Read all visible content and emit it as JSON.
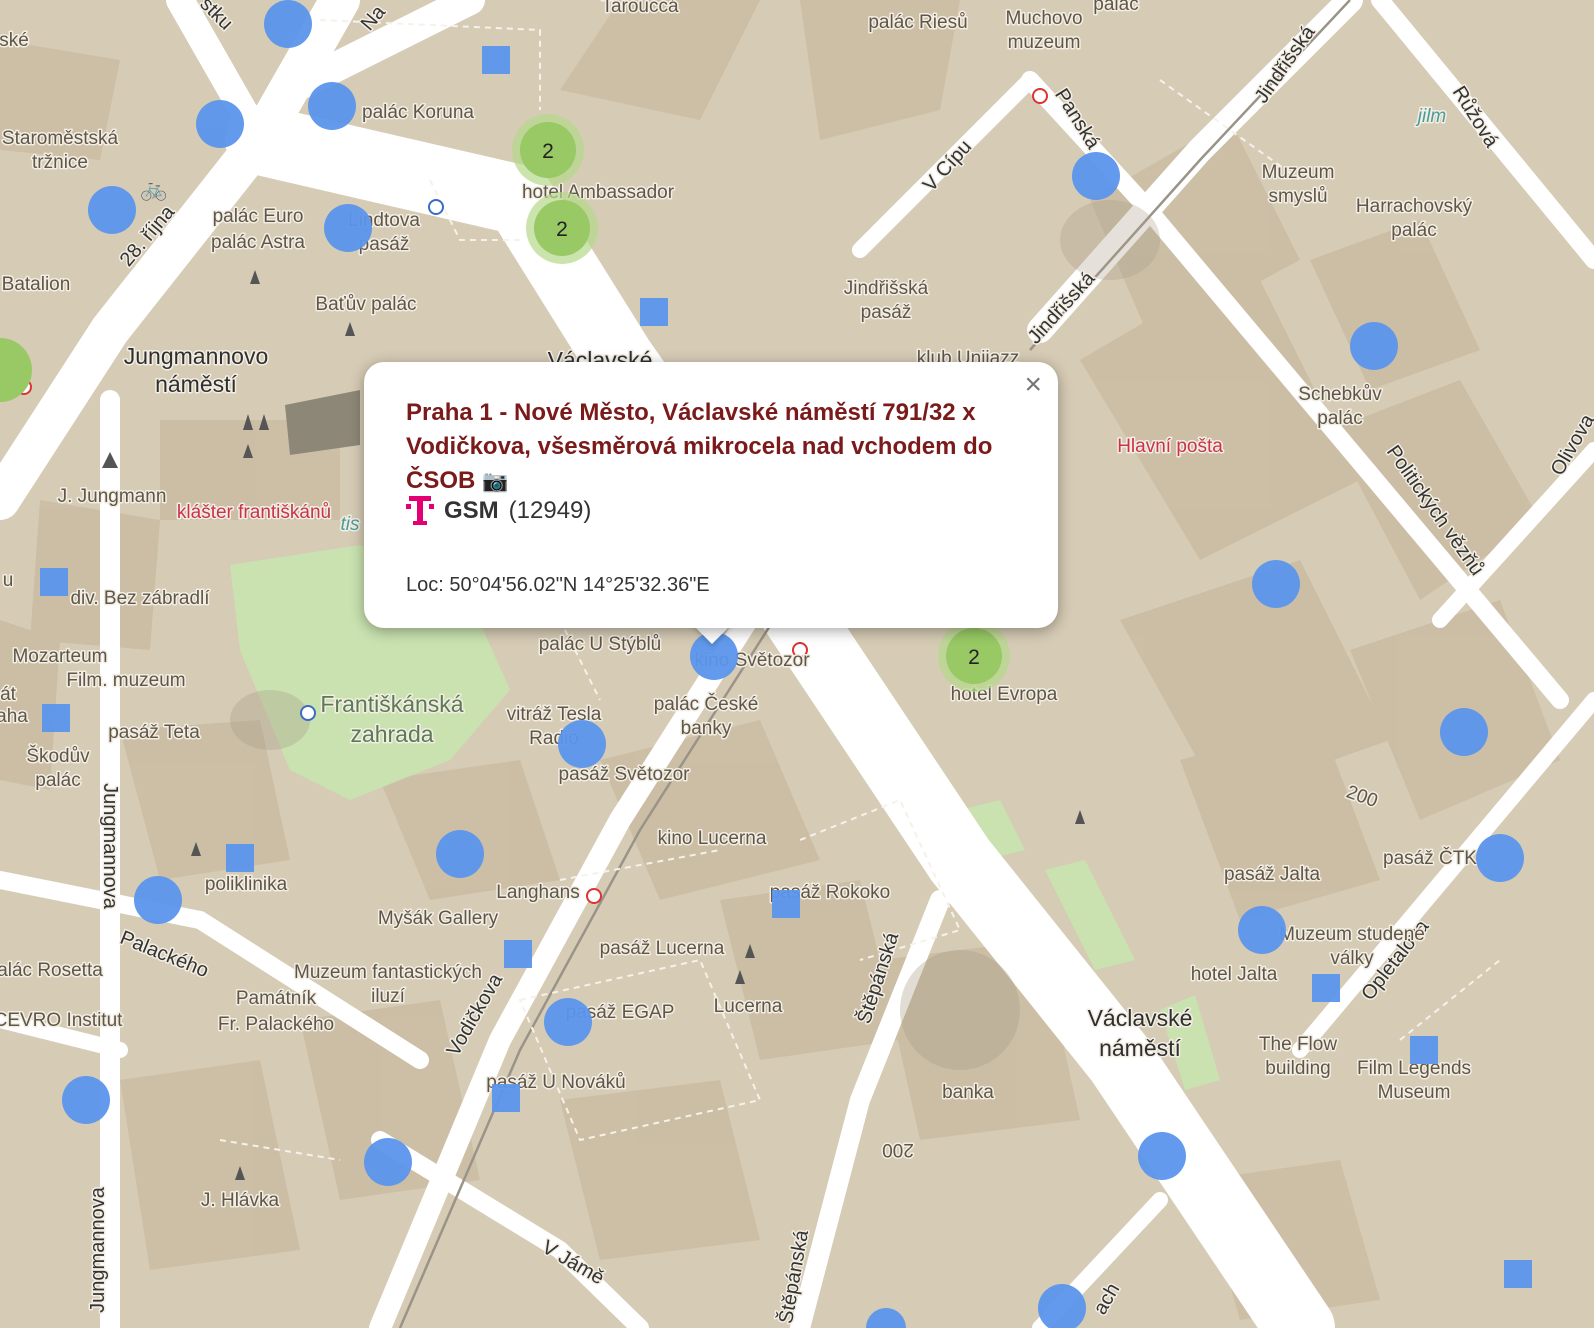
{
  "popup": {
    "title": "Praha 1 - Nové Město, Václavské náměstí 791/32 x Vodičkova, všesměrová mikrocela nad vchodem do ČSOB",
    "camera_icon": "📷",
    "operator_icon": "telekom-logo",
    "network": "GSM",
    "cell_id": "(12949)",
    "loc_label": "Loc:",
    "loc_value": "50°04'56.02\"N 14°25'32.36\"E",
    "close_label": "×"
  },
  "map_labels": {
    "jungmannovo": [
      "Jungmannovo",
      "náměstí"
    ],
    "vaclavske": [
      "Václavské",
      "náměstí"
    ],
    "vaclavske_top": "Václavské",
    "frantiskanska": [
      "Františkánská",
      "zahrada"
    ],
    "hlavni_posta": "Hlavní pošta",
    "klaster": "klášter františkánů",
    "tis": "tis",
    "jilm": "jilm",
    "palac_koruna": "palác Koruna",
    "staromestska": [
      "Staroměstská",
      "tržnice"
    ],
    "tarouca": "Tarouccá",
    "palac_riesu": "palác Riesů",
    "muchovo": [
      "Muchovo",
      "muzeum"
    ],
    "palac_top": "palác",
    "hotel_ambassador": "hotel Ambassador",
    "palac_euro": "palác Euro",
    "palac_astra": "palác Astra",
    "lindtova": [
      "Lindtova",
      "pasáž"
    ],
    "batalion": "Batalion",
    "batuv": "Baťův palác",
    "jindrisska_pasaz": [
      "Jindřišská",
      "pasáž"
    ],
    "klub": "klub Unijazz",
    "muzeum_smyslu": [
      "Muzeum",
      "smyslů"
    ],
    "harrachovsky": [
      "Harrachovský",
      "palác"
    ],
    "schebkuv": [
      "Schebkův",
      "palác"
    ],
    "j_jungmann": "J. Jungmann",
    "div_bez": "div. Bez zábradlí",
    "mozarteum": "Mozarteum",
    "film_muzeum": "Film. muzeum",
    "pasaz_teta": "pasáž Teta",
    "skoduv": [
      "Škodův",
      "palác"
    ],
    "palac_styblu": "palác U Stýblů",
    "kino_svetozor": "kino Světozor",
    "palac_ceske": [
      "palác České",
      "banky"
    ],
    "vitraz": [
      "vitráž Tesla",
      "Radio"
    ],
    "pasaz_svetozor": "pasáž Světozor",
    "hotel_evropa": "hotel Evropa",
    "kino_lucerna": "kino Lucerna",
    "langhans": "Langhans",
    "pasaz_rokoko": "pasáž Rokoko",
    "mysak": "Myšák Gallery",
    "pasaz_lucerna": "pasáž Lucerna",
    "muzeum_iluzi": [
      "Muzeum fantastických",
      "iluzí"
    ],
    "lucerna": "Lucerna",
    "pamatnik": [
      "Památník",
      "Fr. Palackého"
    ],
    "pasaz_egap": "pasáž EGAP",
    "pasaz_novaku": "pasáž U Nováků",
    "poliklinika": "poliklinika",
    "palac_rosetta": "palác Rosetta",
    "cevro": "CEVRO Institut",
    "j_hlavka": "J. Hlávka",
    "banka": "banka",
    "pasaz_jalta": "pasáž Jalta",
    "pasaz_ctk": "pasáž ČTK",
    "muzeum_studene": [
      "Muzeum studené",
      "války"
    ],
    "hotel_jalta": "hotel Jalta",
    "the_flow": [
      "The Flow",
      "building"
    ],
    "film_legends": [
      "Film Legends",
      "Museum"
    ],
    "elev_200a": "200",
    "elev_200b": "200",
    "edge_ske": [
      "ské",
      "."
    ],
    "edge_u": [
      "u",
      ")",
      "a"
    ],
    "edge_at": [
      "át",
      "aha"
    ],
    "edge_alac": "alác Rosetta"
  },
  "street_labels": {
    "na_prikope": "Na",
    "stku": "stku",
    "rijna": "28. října",
    "v_cipu": "V Cípu",
    "panska": "Panská",
    "jindrisska1": "Jindřišská",
    "jindrisska2": "Jindřišská",
    "ruzova": "Růžová",
    "politickych": "Politických vězňů",
    "olivova": "Olivova",
    "jungmannova1": "Jungmannova",
    "jungmannova2": "Jungmannova",
    "palackeho": "Palackého",
    "vodickova": "Vodičkova",
    "stepanska1": "Štěpánská",
    "stepanska2": "Štěpánská",
    "opletalova": "Opletalova",
    "v_jame": "V Jámě",
    "ach": "ach"
  },
  "clusters": [
    {
      "count": "2"
    },
    {
      "count": "2"
    },
    {
      "count": "2"
    }
  ],
  "colors": {
    "marker_blue": "#5b95ec",
    "cluster_green": "#98c964",
    "cluster_halo": "#b5d98b",
    "title_red": "#7b1a1a",
    "telekom_magenta": "#e20074",
    "land": "#d6cbb5",
    "park": "#c9e2b0",
    "road": "#ffffff"
  }
}
